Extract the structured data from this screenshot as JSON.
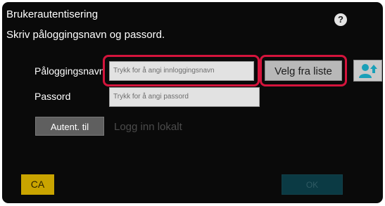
{
  "dialog": {
    "title": "Brukerautentisering",
    "help_icon": "?",
    "instruction": "Skriv påloggingsnavn og passord."
  },
  "login": {
    "label": "Påloggingsnavn",
    "placeholder": "Trykk for å angi innloggingsnavn",
    "select_button": "Velg fra liste",
    "user_list_icon": "user-arrow-icon"
  },
  "password": {
    "label": "Passord",
    "placeholder": "Trykk for å angi passord"
  },
  "auth": {
    "button": "Autent. til",
    "value": "Logg inn lokalt"
  },
  "footer": {
    "ca_button": "CA",
    "ok_button": "OK"
  },
  "colors": {
    "highlight": "#d4143c",
    "ca": "#c9a400",
    "ok_disabled": "#0b3a44",
    "user_icon": "#1aa0b8"
  }
}
